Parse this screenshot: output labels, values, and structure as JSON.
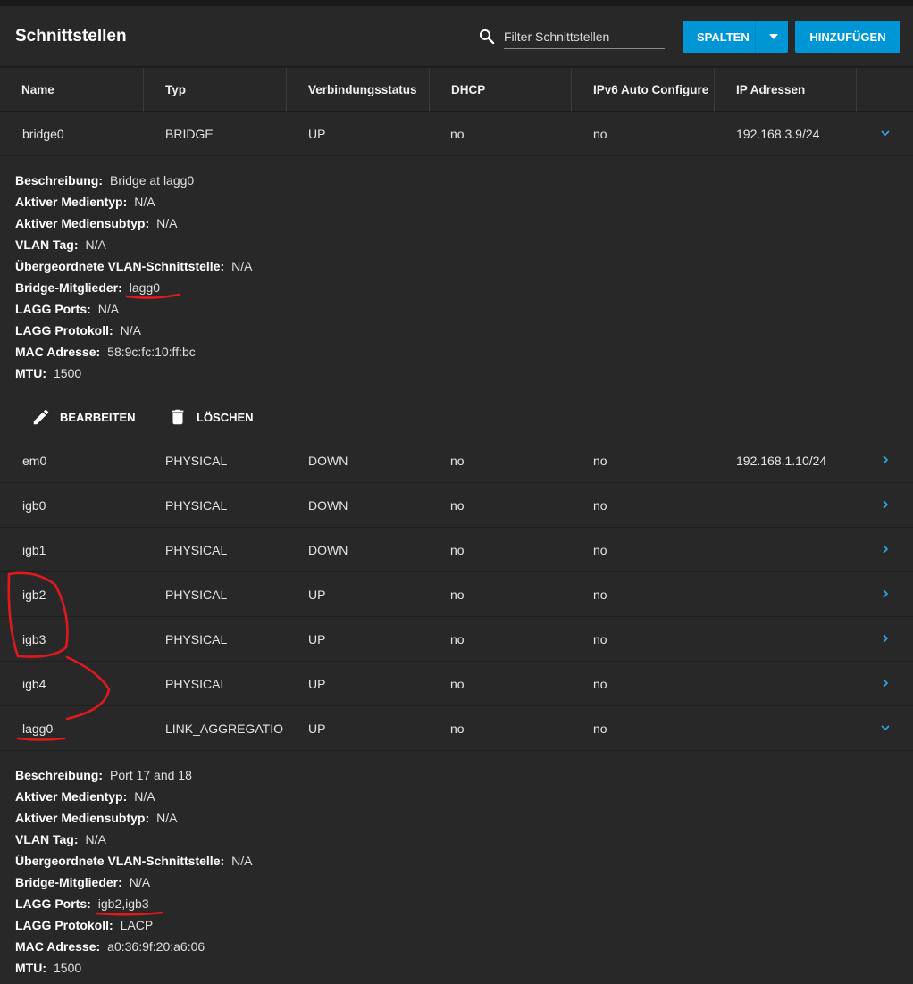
{
  "header": {
    "title": "Schnittstellen",
    "search_placeholder": "Filter Schnittstellen",
    "columns_button": "SPALTEN",
    "add_button": "HINZUFÜGEN"
  },
  "columns": [
    "Name",
    "Typ",
    "Verbindungsstatus",
    "DHCP",
    "IPv6 Auto Configure",
    "IP Adressen"
  ],
  "rows": [
    {
      "name": "bridge0",
      "type": "BRIDGE",
      "status": "UP",
      "dhcp": "no",
      "ipv6": "no",
      "ip": "192.168.3.9/24",
      "expanded": true
    },
    {
      "name": "em0",
      "type": "PHYSICAL",
      "status": "DOWN",
      "dhcp": "no",
      "ipv6": "no",
      "ip": "192.168.1.10/24",
      "expanded": false
    },
    {
      "name": "igb0",
      "type": "PHYSICAL",
      "status": "DOWN",
      "dhcp": "no",
      "ipv6": "no",
      "ip": "",
      "expanded": false
    },
    {
      "name": "igb1",
      "type": "PHYSICAL",
      "status": "DOWN",
      "dhcp": "no",
      "ipv6": "no",
      "ip": "",
      "expanded": false
    },
    {
      "name": "igb2",
      "type": "PHYSICAL",
      "status": "UP",
      "dhcp": "no",
      "ipv6": "no",
      "ip": "",
      "expanded": false
    },
    {
      "name": "igb3",
      "type": "PHYSICAL",
      "status": "UP",
      "dhcp": "no",
      "ipv6": "no",
      "ip": "",
      "expanded": false
    },
    {
      "name": "igb4",
      "type": "PHYSICAL",
      "status": "UP",
      "dhcp": "no",
      "ipv6": "no",
      "ip": "",
      "expanded": false
    },
    {
      "name": "lagg0",
      "type": "LINK_AGGREGATIO",
      "status": "UP",
      "dhcp": "no",
      "ipv6": "no",
      "ip": "",
      "expanded": true
    }
  ],
  "details": {
    "bridge0": [
      {
        "label": "Beschreibung:",
        "value": "Bridge at lagg0"
      },
      {
        "label": "Aktiver Medientyp:",
        "value": "N/A"
      },
      {
        "label": "Aktiver Mediensubtyp:",
        "value": "N/A"
      },
      {
        "label": "VLAN Tag:",
        "value": "N/A"
      },
      {
        "label": "Übergeordnete VLAN-Schnittstelle:",
        "value": "N/A"
      },
      {
        "label": "Bridge-Mitglieder:",
        "value": "lagg0"
      },
      {
        "label": "LAGG Ports:",
        "value": "N/A"
      },
      {
        "label": "LAGG Protokoll:",
        "value": "N/A"
      },
      {
        "label": "MAC Adresse:",
        "value": "58:9c:fc:10:ff:bc"
      },
      {
        "label": "MTU:",
        "value": "1500"
      }
    ],
    "lagg0": [
      {
        "label": "Beschreibung:",
        "value": "Port 17 and 18"
      },
      {
        "label": "Aktiver Medientyp:",
        "value": "N/A"
      },
      {
        "label": "Aktiver Mediensubtyp:",
        "value": "N/A"
      },
      {
        "label": "VLAN Tag:",
        "value": "N/A"
      },
      {
        "label": "Übergeordnete VLAN-Schnittstelle:",
        "value": "N/A"
      },
      {
        "label": "Bridge-Mitglieder:",
        "value": "N/A"
      },
      {
        "label": "LAGG Ports:",
        "value": "igb2,igb3"
      },
      {
        "label": "LAGG Protokoll:",
        "value": "LACP"
      },
      {
        "label": "MAC Adresse:",
        "value": "a0:36:9f:20:a6:06"
      },
      {
        "label": "MTU:",
        "value": "1500"
      }
    ]
  },
  "actions": {
    "edit_label": "BEARBEITEN",
    "delete_label": "LÖSCHEN"
  },
  "colors": {
    "accent": "#0095d5",
    "annotation": "#e0191e"
  }
}
